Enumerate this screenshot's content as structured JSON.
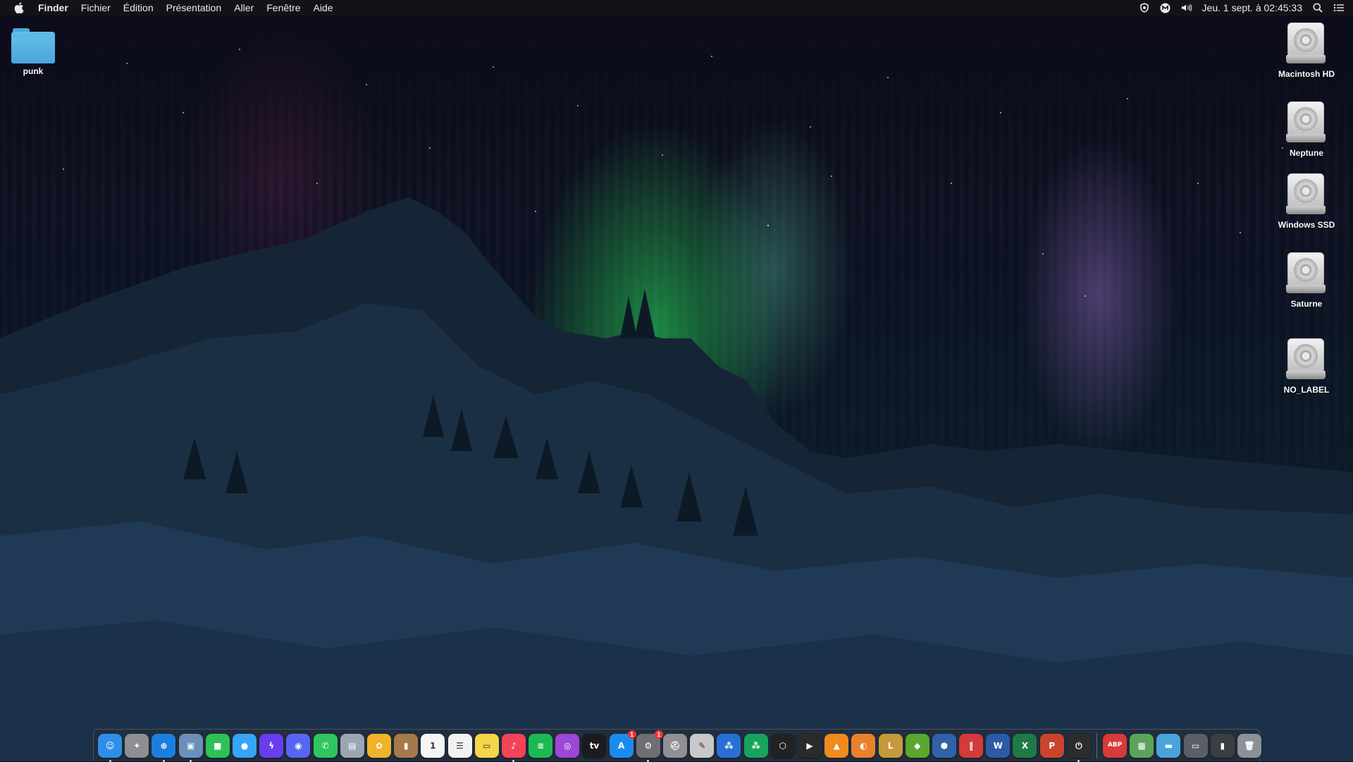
{
  "menubar": {
    "apple": "",
    "app_name": "Finder",
    "menus": [
      "Fichier",
      "Édition",
      "Présentation",
      "Aller",
      "Fenêtre",
      "Aide"
    ],
    "status_icons": [
      "vpn-shield-icon",
      "malwarebytes-icon",
      "volume-icon"
    ],
    "clock": "Jeu. 1 sept. à  02:45:33",
    "trailing_icons": [
      "spotlight-search-icon",
      "control-center-icon"
    ]
  },
  "desktop": {
    "folder": {
      "label": "punk"
    },
    "disks": [
      {
        "label": "Macintosh HD"
      },
      {
        "label": "Neptune"
      },
      {
        "label": "Windows SSD"
      },
      {
        "label": "Saturne"
      },
      {
        "label": "NO_LABEL"
      }
    ]
  },
  "dock": {
    "apps": [
      {
        "name": "finder",
        "glyph": "☺",
        "color": "#2f8fe8",
        "running": true
      },
      {
        "name": "launchpad",
        "glyph": "✦",
        "color": "#8e8e93",
        "running": false
      },
      {
        "name": "safari",
        "glyph": "⊕",
        "color": "#1c7fe0",
        "running": true
      },
      {
        "name": "preview",
        "glyph": "▣",
        "color": "#6b8fb8",
        "running": true
      },
      {
        "name": "facetime",
        "glyph": "■",
        "color": "#2ec155",
        "running": false
      },
      {
        "name": "messages",
        "glyph": "●",
        "color": "#35a5f5",
        "running": false
      },
      {
        "name": "messenger",
        "glyph": "ϟ",
        "color": "#6a3cf0",
        "running": false
      },
      {
        "name": "discord",
        "glyph": "◉",
        "color": "#5865f2",
        "running": false
      },
      {
        "name": "whatsapp",
        "glyph": "✆",
        "color": "#2fc55f",
        "running": false
      },
      {
        "name": "image-capture",
        "glyph": "▤",
        "color": "#9aa6b4",
        "running": false
      },
      {
        "name": "photos",
        "glyph": "✿",
        "color": "#f1b22c",
        "running": false
      },
      {
        "name": "notefile",
        "glyph": "▮",
        "color": "#a57a4a",
        "running": false
      },
      {
        "name": "calendar",
        "glyph": "1",
        "color": "#f5f5f5",
        "running": false
      },
      {
        "name": "reminders",
        "glyph": "☰",
        "color": "#f2f2f2",
        "running": false
      },
      {
        "name": "notes",
        "glyph": "▭",
        "color": "#f6d54a",
        "running": false
      },
      {
        "name": "music",
        "glyph": "♪",
        "color": "#f2435a",
        "running": true
      },
      {
        "name": "spotify",
        "glyph": "≋",
        "color": "#1db954",
        "running": false
      },
      {
        "name": "podcasts",
        "glyph": "◎",
        "color": "#9c47d6",
        "running": false
      },
      {
        "name": "apple-tv",
        "glyph": "tv",
        "color": "#1c1c1e",
        "running": false
      },
      {
        "name": "app-store",
        "glyph": "A",
        "color": "#1a8cf0",
        "running": false,
        "badge": "1"
      },
      {
        "name": "system-preferences",
        "glyph": "⚙",
        "color": "#6e6e73",
        "running": true,
        "badge": "1"
      },
      {
        "name": "disk-utility",
        "glyph": "⛑",
        "color": "#8f8f94",
        "running": false
      },
      {
        "name": "script-editor",
        "glyph": "✎",
        "color": "#c8c8c8",
        "running": false
      },
      {
        "name": "audio-app-blue",
        "glyph": "⁂",
        "color": "#2a6fd6",
        "running": false
      },
      {
        "name": "audio-app-green",
        "glyph": "⁂",
        "color": "#18a35c",
        "running": false
      },
      {
        "name": "unity",
        "glyph": "⬡",
        "color": "#222222",
        "running": false
      },
      {
        "name": "final-cut",
        "glyph": "▶",
        "color": "#2b2b2b",
        "running": false
      },
      {
        "name": "vlc",
        "glyph": "▲",
        "color": "#f08a1c",
        "running": false
      },
      {
        "name": "overwatch",
        "glyph": "◐",
        "color": "#e7812b",
        "running": false
      },
      {
        "name": "league-of-legends",
        "glyph": "L",
        "color": "#c59a3c",
        "running": false
      },
      {
        "name": "minecraft",
        "glyph": "◆",
        "color": "#5aa62f",
        "running": false
      },
      {
        "name": "virtualbox",
        "glyph": "⬢",
        "color": "#2f63a6",
        "running": false
      },
      {
        "name": "parallels",
        "glyph": "‖",
        "color": "#d33b3b",
        "running": false
      },
      {
        "name": "word",
        "glyph": "W",
        "color": "#2b5ba8",
        "running": false
      },
      {
        "name": "excel",
        "glyph": "X",
        "color": "#1f7a45",
        "running": false
      },
      {
        "name": "powerpoint",
        "glyph": "P",
        "color": "#c8452b",
        "running": false
      },
      {
        "name": "time-machine-app",
        "glyph": "⏻",
        "color": "#2c2c2e",
        "running": true
      }
    ],
    "others": [
      {
        "name": "adblock-plus",
        "glyph": "ABP",
        "color": "#d63a3a"
      },
      {
        "name": "archive-utility",
        "glyph": "▦",
        "color": "#5ea35b"
      },
      {
        "name": "downloads-folder",
        "glyph": "▬",
        "color": "#4aa4d9"
      },
      {
        "name": "system-stack",
        "glyph": "▭",
        "color": "#5a5f66"
      },
      {
        "name": "apps-stack",
        "glyph": "▮",
        "color": "#3a3d42"
      },
      {
        "name": "trash",
        "glyph": "🗑",
        "color": "#8d9096"
      }
    ]
  }
}
